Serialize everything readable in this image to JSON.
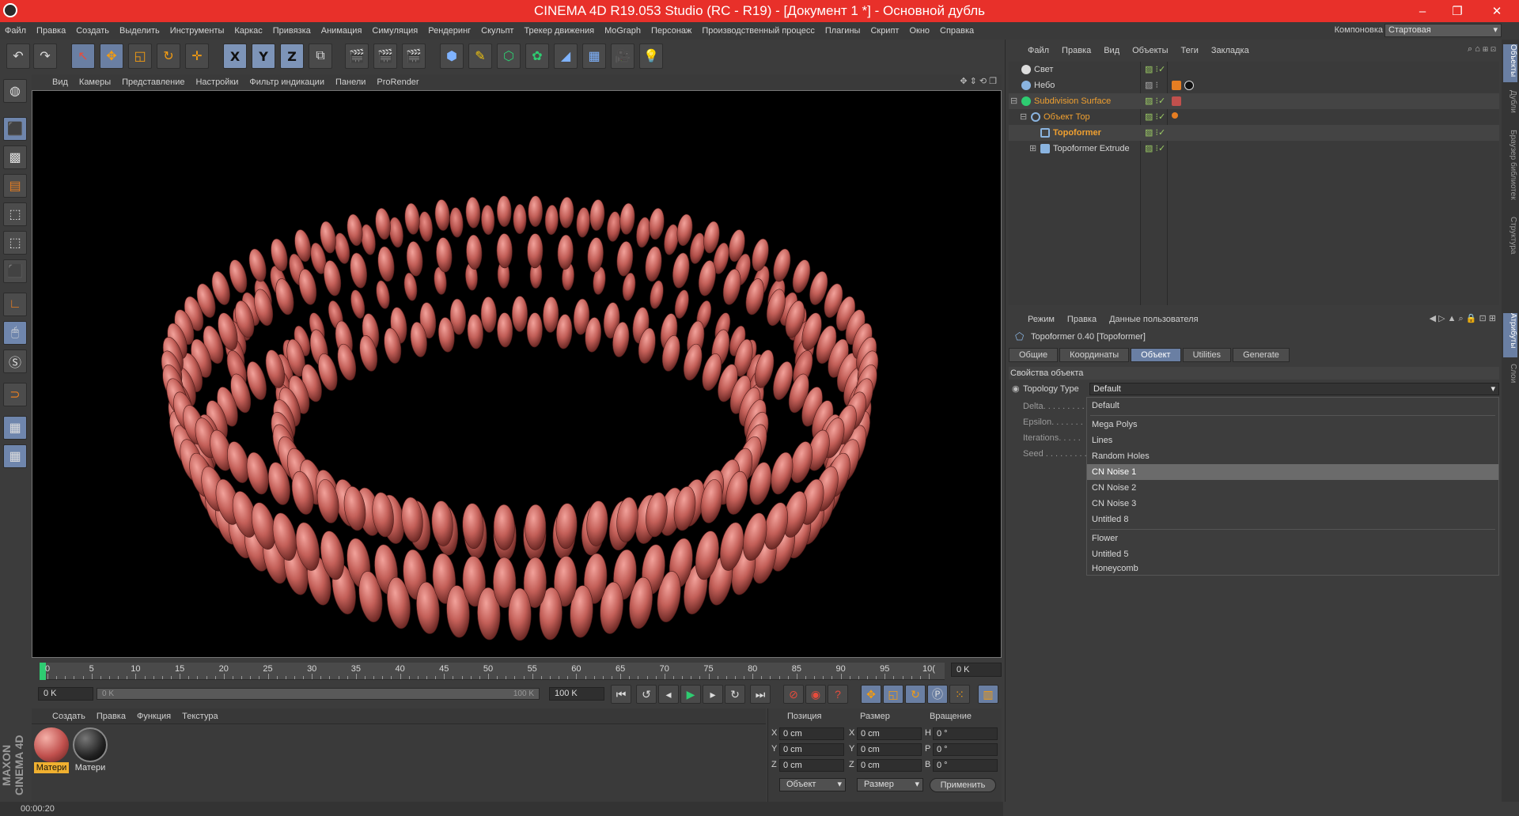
{
  "window": {
    "title": "CINEMA 4D R19.053 Studio (RC - R19) - [Документ 1 *] - Основной дубль",
    "min": "–",
    "max": "❐",
    "close": "✕"
  },
  "menubar": {
    "items": [
      "Файл",
      "Правка",
      "Создать",
      "Выделить",
      "Инструменты",
      "Каркас",
      "Привязка",
      "Анимация",
      "Симуляция",
      "Рендеринг",
      "Скульпт",
      "Трекер движения",
      "MoGraph",
      "Персонаж",
      "Производственный процесс",
      "Плагины",
      "Скрипт",
      "Окно",
      "Справка"
    ],
    "layout_label": "Компоновка",
    "layout_value": "Стартовая"
  },
  "toolbar": {
    "x": "X",
    "y": "Y",
    "z": "Z"
  },
  "viewport": {
    "menu": [
      "Вид",
      "Камеры",
      "Представление",
      "Настройки",
      "Фильтр индикации",
      "Панели",
      "ProRender"
    ]
  },
  "timeline": {
    "ticks": [
      "0",
      "5",
      "10",
      "15",
      "20",
      "25",
      "30",
      "35",
      "40",
      "45",
      "50",
      "55",
      "60",
      "65",
      "70",
      "75",
      "80",
      "85",
      "90",
      "95",
      "10("
    ],
    "current_frame": "0 K"
  },
  "playbar": {
    "start": "0 K",
    "range_start": "0 K",
    "range_end": "100 K",
    "end": "100 K"
  },
  "materials": {
    "menu": [
      "Создать",
      "Правка",
      "Функция",
      "Текстура"
    ],
    "items": [
      {
        "label": "Матери",
        "color": "#c0504d"
      },
      {
        "label": "Матери",
        "color": "#222222"
      }
    ]
  },
  "coords": {
    "heads": {
      "pos": "Позиция",
      "size": "Размер",
      "rot": "Вращение"
    },
    "rows": [
      {
        "a1": "X",
        "v1": "0 cm",
        "a2": "X",
        "v2": "0 cm",
        "a3": "H",
        "v3": "0 °"
      },
      {
        "a1": "Y",
        "v1": "0 cm",
        "a2": "Y",
        "v2": "0 cm",
        "a3": "P",
        "v3": "0 °"
      },
      {
        "a1": "Z",
        "v1": "0 cm",
        "a2": "Z",
        "v2": "0 cm",
        "a3": "B",
        "v3": "0 °"
      }
    ],
    "mode": "Объект",
    "size_mode": "Размер",
    "apply": "Применить"
  },
  "status": {
    "time": "00:00:20"
  },
  "objects": {
    "menu": [
      "Файл",
      "Правка",
      "Вид",
      "Объекты",
      "Теги",
      "Закладка"
    ],
    "items": [
      {
        "name": "Свет"
      },
      {
        "name": "Небо"
      },
      {
        "name": "Subdivision Surface"
      },
      {
        "name": "Объект Тор"
      },
      {
        "name": "Topoformer"
      },
      {
        "name": "Topoformer Extrude"
      }
    ]
  },
  "side_tabs_top": [
    "Объекты",
    "Дубли",
    "Браузер библиотек",
    "Структура"
  ],
  "side_tabs_bottom": [
    "Атрибуты",
    "Слои"
  ],
  "attributes": {
    "menu": [
      "Режим",
      "Правка",
      "Данные пользователя"
    ],
    "title": "Topoformer 0.40 [Topoformer]",
    "tabs": [
      "Общие",
      "Координаты",
      "Объект",
      "Utilities",
      "Generate"
    ],
    "section": "Свойства объекта",
    "topology_label": "Topology Type",
    "topology_value": "Default",
    "params": [
      "Delta. . . . . . . . .",
      "Epsilon. . . . . . .",
      "Iterations. . . . .",
      "Seed . . . . . . . . ."
    ],
    "dropdown": [
      "Default",
      "Mega Polys",
      "Lines",
      "Random Holes",
      "CN Noise 1",
      "CN Noise 2",
      "CN Noise 3",
      "Untitled 8",
      "Flower",
      "Untitled 5",
      "Honeycomb"
    ]
  }
}
